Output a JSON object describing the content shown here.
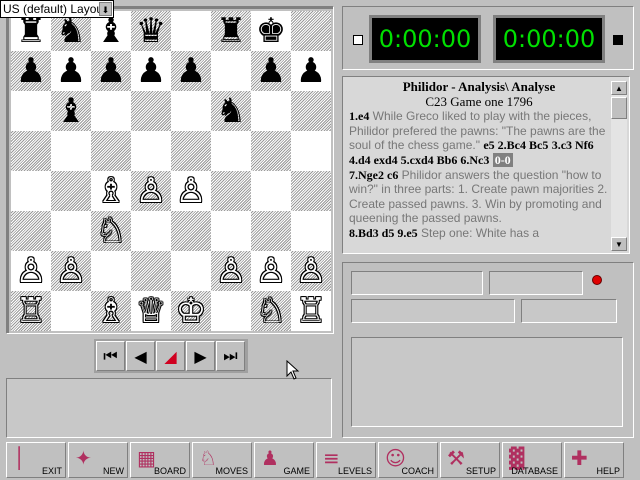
{
  "layout_select": {
    "value": "US (default) Layout",
    "arrow_icon": "download-arrow-icon"
  },
  "board": {
    "rows": [
      [
        "♜",
        "♞",
        "♝",
        "♛",
        "",
        "♜",
        "♚",
        ""
      ],
      [
        "♟",
        "♟",
        "♟",
        "♟",
        "♟",
        "",
        "♟",
        "♟"
      ],
      [
        "",
        "♝",
        "",
        "",
        "",
        "♞",
        "",
        ""
      ],
      [
        "",
        "",
        "",
        "",
        "",
        "",
        "",
        ""
      ],
      [
        "",
        "",
        "♗",
        "♙",
        "♙",
        "",
        "",
        ""
      ],
      [
        "",
        "",
        "♘",
        "",
        "",
        "",
        "",
        ""
      ],
      [
        "♙",
        "♙",
        "",
        "",
        "",
        "♙",
        "♙",
        "♙"
      ],
      [
        "♖",
        "",
        "♗",
        "♕",
        "♔",
        "",
        "♘",
        "♖"
      ]
    ],
    "colors": [
      [
        "b",
        "b",
        "b",
        "b",
        "",
        "b",
        "b",
        ""
      ],
      [
        "b",
        "b",
        "b",
        "b",
        "b",
        "",
        "b",
        "b"
      ],
      [
        "",
        "b",
        "",
        "",
        "",
        "b",
        "",
        ""
      ],
      [
        "",
        "",
        "",
        "",
        "",
        "",
        "",
        ""
      ],
      [
        "",
        "",
        "w",
        "w",
        "w",
        "",
        "",
        ""
      ],
      [
        "",
        "",
        "w",
        "",
        "",
        "",
        "",
        ""
      ],
      [
        "w",
        "w",
        "",
        "",
        "",
        "w",
        "w",
        "w"
      ],
      [
        "w",
        "",
        "w",
        "w",
        "w",
        "",
        "w",
        "w"
      ]
    ]
  },
  "nav": {
    "first": "⏮",
    "back": "◀",
    "arrow": "◢",
    "forward": "▶",
    "last": "⏭"
  },
  "clocks": {
    "white": "0:00:00",
    "black": "0:00:00"
  },
  "notation": {
    "title": "Philidor - Analysis\\ Analyse",
    "subtitle": "C23 Game one 1796",
    "m1": "1.e4",
    "c1": "While Greco liked to play with the pieces, Philidor prefered the pawns: \"The pawns are the soul of the chess game.\"",
    "m2": "e5  2.Bc4  Bc5",
    "m3": "3.c3  Nf6  4.d4  exd4  5.cxd4  Bb6  6.Nc3",
    "m3cur": "0-0",
    "m4": "7.Nge2  c6",
    "c2": "Philidor answers the question \"how to win?\" in three parts: 1. Create pawn majorities 2. Create passed pawns. 3. Win by promoting and queening the passed pawns.",
    "m5": "8.Bd3  d5  9.e5",
    "c3": "Step one: White has a"
  },
  "toolbar": [
    {
      "label": "EXIT",
      "icon": "exit-door-icon",
      "glyph": "│"
    },
    {
      "label": "NEW",
      "icon": "new-game-icon",
      "glyph": "✦"
    },
    {
      "label": "BOARD",
      "icon": "board-icon",
      "glyph": "▦"
    },
    {
      "label": "MOVES",
      "icon": "moves-icon",
      "glyph": "♘"
    },
    {
      "label": "GAME",
      "icon": "game-icon",
      "glyph": "♟"
    },
    {
      "label": "LEVELS",
      "icon": "levels-icon",
      "glyph": "≡"
    },
    {
      "label": "COACH",
      "icon": "coach-icon",
      "glyph": "☺"
    },
    {
      "label": "SETUP",
      "icon": "setup-tools-icon",
      "glyph": "⚒"
    },
    {
      "label": "DATABASE",
      "icon": "database-icon",
      "glyph": "▓"
    },
    {
      "label": "HELP",
      "icon": "help-icon",
      "glyph": "✚"
    }
  ],
  "accent_color": "#b03060",
  "clock_color": "#00e000"
}
